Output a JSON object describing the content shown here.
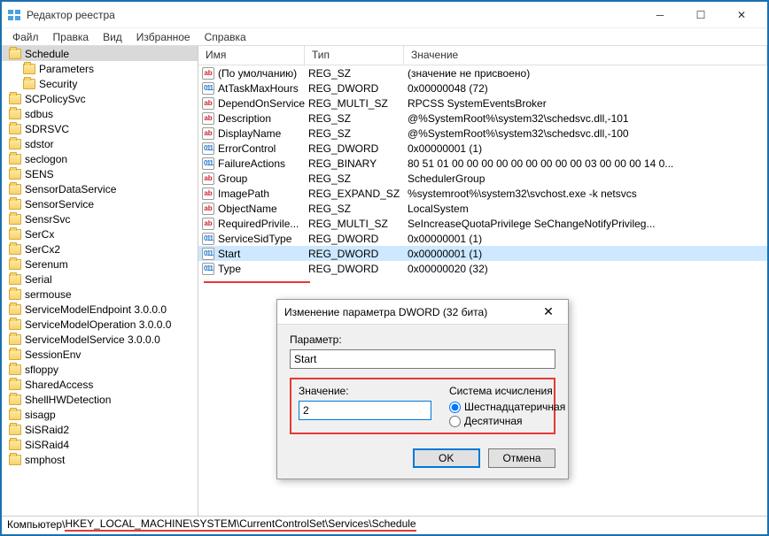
{
  "window": {
    "title": "Редактор реестра"
  },
  "menu": {
    "file": "Файл",
    "edit": "Правка",
    "view": "Вид",
    "favorites": "Избранное",
    "help": "Справка"
  },
  "tree": {
    "selected": "Schedule",
    "items": [
      {
        "label": "Schedule",
        "selected": true
      },
      {
        "label": "Parameters",
        "child": true
      },
      {
        "label": "Security",
        "child": true
      },
      {
        "label": "SCPolicySvc"
      },
      {
        "label": "sdbus"
      },
      {
        "label": "SDRSVC"
      },
      {
        "label": "sdstor"
      },
      {
        "label": "seclogon"
      },
      {
        "label": "SENS"
      },
      {
        "label": "SensorDataService"
      },
      {
        "label": "SensorService"
      },
      {
        "label": "SensrSvc"
      },
      {
        "label": "SerCx"
      },
      {
        "label": "SerCx2"
      },
      {
        "label": "Serenum"
      },
      {
        "label": "Serial"
      },
      {
        "label": "sermouse"
      },
      {
        "label": "ServiceModelEndpoint 3.0.0.0"
      },
      {
        "label": "ServiceModelOperation 3.0.0.0"
      },
      {
        "label": "ServiceModelService 3.0.0.0"
      },
      {
        "label": "SessionEnv"
      },
      {
        "label": "sfloppy"
      },
      {
        "label": "SharedAccess"
      },
      {
        "label": "ShellHWDetection"
      },
      {
        "label": "sisagp"
      },
      {
        "label": "SiSRaid2"
      },
      {
        "label": "SiSRaid4"
      },
      {
        "label": "smphost"
      }
    ]
  },
  "columns": {
    "name": "Имя",
    "type": "Тип",
    "value": "Значение"
  },
  "rows": [
    {
      "icon": "sz",
      "name": "(По умолчанию)",
      "type": "REG_SZ",
      "value": "(значение не присвоено)"
    },
    {
      "icon": "dw",
      "name": "AtTaskMaxHours",
      "type": "REG_DWORD",
      "value": "0x00000048 (72)"
    },
    {
      "icon": "sz",
      "name": "DependOnService",
      "type": "REG_MULTI_SZ",
      "value": "RPCSS SystemEventsBroker"
    },
    {
      "icon": "sz",
      "name": "Description",
      "type": "REG_SZ",
      "value": "@%SystemRoot%\\system32\\schedsvc.dll,-101"
    },
    {
      "icon": "sz",
      "name": "DisplayName",
      "type": "REG_SZ",
      "value": "@%SystemRoot%\\system32\\schedsvc.dll,-100"
    },
    {
      "icon": "dw",
      "name": "ErrorControl",
      "type": "REG_DWORD",
      "value": "0x00000001 (1)"
    },
    {
      "icon": "dw",
      "name": "FailureActions",
      "type": "REG_BINARY",
      "value": "80 51 01 00 00 00 00 00 00 00 00 00 03 00 00 00 14 0..."
    },
    {
      "icon": "sz",
      "name": "Group",
      "type": "REG_SZ",
      "value": "SchedulerGroup"
    },
    {
      "icon": "sz",
      "name": "ImagePath",
      "type": "REG_EXPAND_SZ",
      "value": "%systemroot%\\system32\\svchost.exe -k netsvcs"
    },
    {
      "icon": "sz",
      "name": "ObjectName",
      "type": "REG_SZ",
      "value": "LocalSystem"
    },
    {
      "icon": "sz",
      "name": "RequiredPrivile...",
      "type": "REG_MULTI_SZ",
      "value": "SeIncreaseQuotaPrivilege SeChangeNotifyPrivileg..."
    },
    {
      "icon": "dw",
      "name": "ServiceSidType",
      "type": "REG_DWORD",
      "value": "0x00000001 (1)"
    },
    {
      "icon": "dw",
      "name": "Start",
      "type": "REG_DWORD",
      "value": "0x00000001 (1)",
      "selected": true
    },
    {
      "icon": "dw",
      "name": "Type",
      "type": "REG_DWORD",
      "value": "0x00000020 (32)"
    }
  ],
  "dialog": {
    "title": "Изменение параметра DWORD (32 бита)",
    "param_label": "Параметр:",
    "param_value": "Start",
    "value_label": "Значение:",
    "value_input": "2",
    "base_label": "Система исчисления",
    "hex": "Шестнадцатеричная",
    "dec": "Десятичная",
    "ok": "OK",
    "cancel": "Отмена"
  },
  "statusbar": {
    "prefix": "Компьютер\\",
    "path": "HKEY_LOCAL_MACHINE\\SYSTEM\\CurrentControlSet\\Services\\Schedule"
  }
}
